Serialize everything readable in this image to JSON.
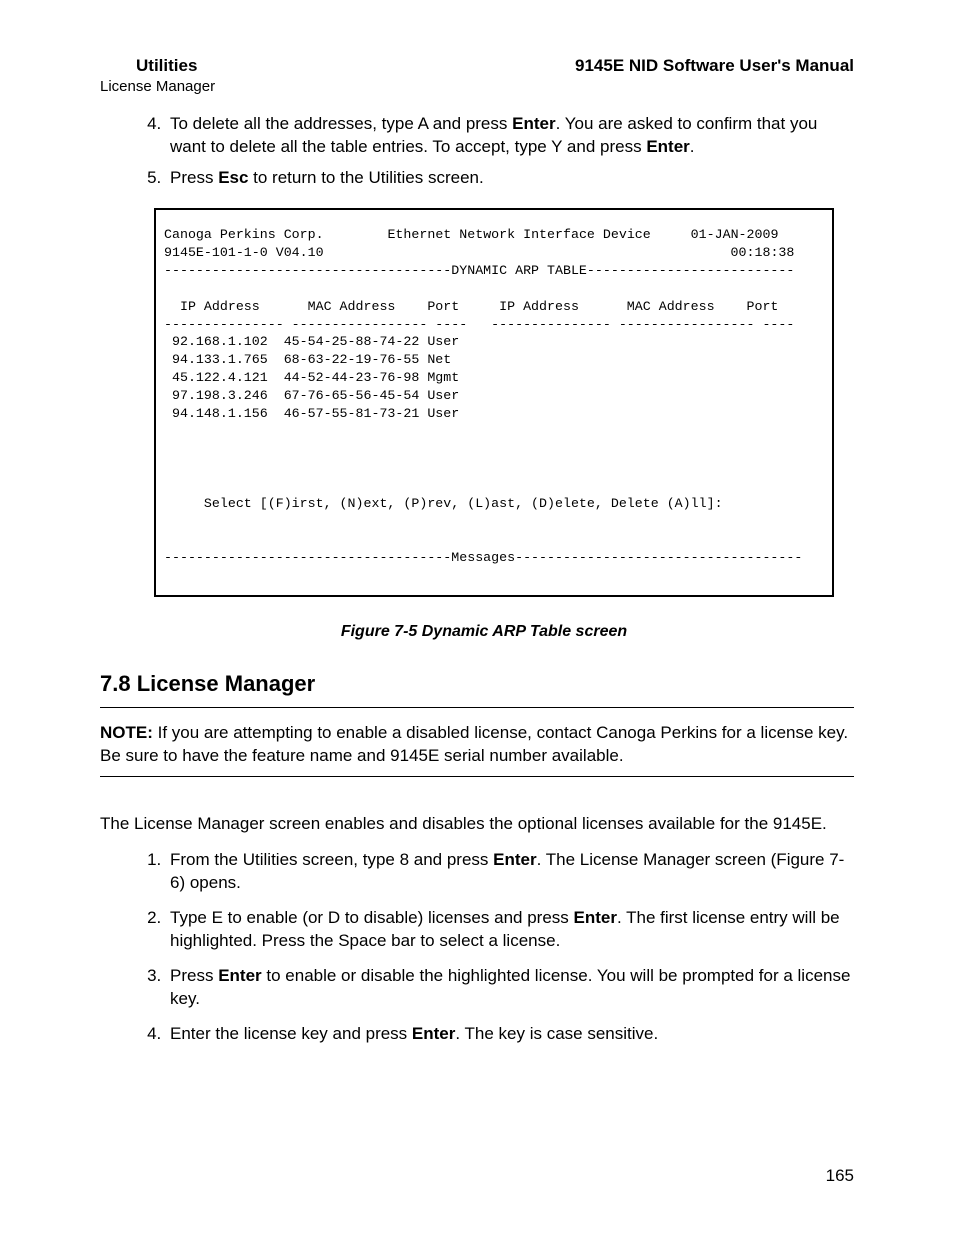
{
  "header": {
    "left": "Utilities",
    "right": "9145E NID Software User's Manual",
    "sub": "License Manager"
  },
  "steps_top": {
    "start": 4,
    "s4_a": "To delete all the addresses, type A and press ",
    "s4_b": "Enter",
    "s4_c": ". You are asked to confirm that you want to delete all the table entries. To accept, type Y and press ",
    "s4_d": "Enter",
    "s4_e": ".",
    "s5_a": "Press ",
    "s5_b": "Esc",
    "s5_c": " to return to the Utilities screen."
  },
  "terminal": {
    "company": "Canoga Perkins Corp.",
    "device_desc": "Ethernet Network Interface Device",
    "date": "01-JAN-2009",
    "model": "9145E-101-1-0 V04.10",
    "time": "00:18:38",
    "rule_title": "------------------------------------DYNAMIC ARP TABLE--------------------------",
    "col_headers": "  IP Address      MAC Address    Port     IP Address      MAC Address    Port",
    "col_rule": "--------------- ----------------- ----   --------------- ----------------- ----",
    "rows": [
      " 92.168.1.102  45-54-25-88-74-22 User",
      " 94.133.1.765  68-63-22-19-76-55 Net",
      " 45.122.4.121  44-52-44-23-76-98 Mgmt",
      " 97.198.3.246  67-76-65-56-45-54 User",
      " 94.148.1.156  46-57-55-81-73-21 User"
    ],
    "prompt": "     Select [(F)irst, (N)ext, (P)rev, (L)ast, (D)elete, Delete (A)ll]:",
    "messages_rule": "------------------------------------Messages------------------------------------"
  },
  "figure_caption": "Figure 7-5  Dynamic ARP Table screen",
  "section_heading": "7.8  License Manager",
  "note": {
    "label": "NOTE:",
    "text": "If you are attempting to enable a disabled license, contact Canoga Perkins for a license key. Be sure to have the feature name and 9145E serial number available."
  },
  "body_para": "The License Manager screen enables and disables the optional licenses available for the 9145E.",
  "steps_bottom": {
    "s1_a": "From the Utilities screen, type 8 and press ",
    "s1_b": "Enter",
    "s1_c": ". The License Manager screen (Figure 7-6) opens.",
    "s2_a": "Type E to enable (or D to disable) licenses and press ",
    "s2_b": "Enter",
    "s2_c": ". The first license entry will be highlighted. Press the Space bar to select a license.",
    "s3_a": "Press ",
    "s3_b": "Enter",
    "s3_c": " to enable or disable the highlighted license. You will be prompted for a license key.",
    "s4_a": "Enter the license key and press ",
    "s4_b": "Enter",
    "s4_c": ". The key is case sensitive."
  },
  "page_number": "165"
}
